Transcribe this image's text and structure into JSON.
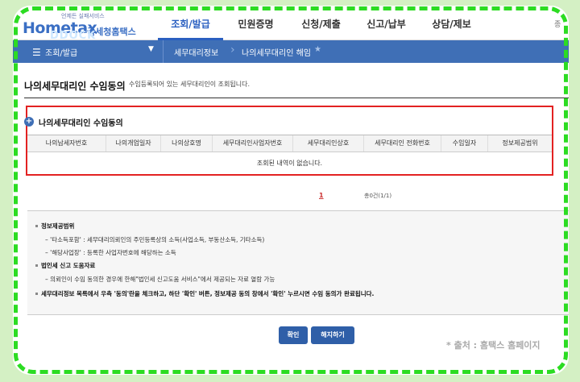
{
  "header": {
    "logo_small": "언제든 실패서비스",
    "logo_main": "Hometax",
    "logo_kr": "국세청홈택스",
    "logo_overlay": "DDOCK",
    "nav": [
      "조회/발급",
      "민원증명",
      "신청/제출",
      "신고/납부",
      "상담/제보"
    ],
    "more": "종"
  },
  "breadcrumb": {
    "level1": "조회/발급",
    "level2": "세무대리정보",
    "level3": "나의세무대리인 해임"
  },
  "page": {
    "title": "나의세무대리인 수임동의",
    "description": "수임등록되어 있는 세무대리인이 조회됩니다."
  },
  "panel": {
    "title": "나의세무대리인 수임동의",
    "columns": [
      "나의납세자번호",
      "나의개업일자",
      "나의상호명",
      "세무대리인사업자번호",
      "세무대리인상호",
      "세무대리인 전화번호",
      "수임일자",
      "정보제공범위"
    ],
    "empty_message": "조회된 내역이 없습니다."
  },
  "pagination": {
    "current": "1",
    "total": "총0건(1/1)"
  },
  "notes": {
    "h1": "정보제공범위",
    "n1": "'타소득포함' : 세무대리의뢰인의 주민등록상의 소득(사업소득, 부동산소득, 기타소득)",
    "n2": "'해당사업장' : 등록한 사업자번호에 해당하는 소득",
    "h2": "법인세 신고 도움자료",
    "n3": "의뢰인이 수임 동의한 경우에 한해\"법인세 신고도움 서비스\"에서 제공되는 자료 열람 가능",
    "h3": "세무대리정보 목록에서 우측 '동의'란을 체크하고, 하단 '확인' 버튼, 정보제공 동의 창에서 '확인' 누르시면 수임 동의가 완료됩니다."
  },
  "buttons": {
    "confirm": "확인",
    "cancel": "해지하기"
  },
  "source": "* 출처 : 홈택스 홈페이지",
  "colors": {
    "accent": "#2a5fc0",
    "crumb_bg": "#3f6fb6",
    "highlight_border": "#e32222",
    "frame_dash": "#2cdc22"
  }
}
